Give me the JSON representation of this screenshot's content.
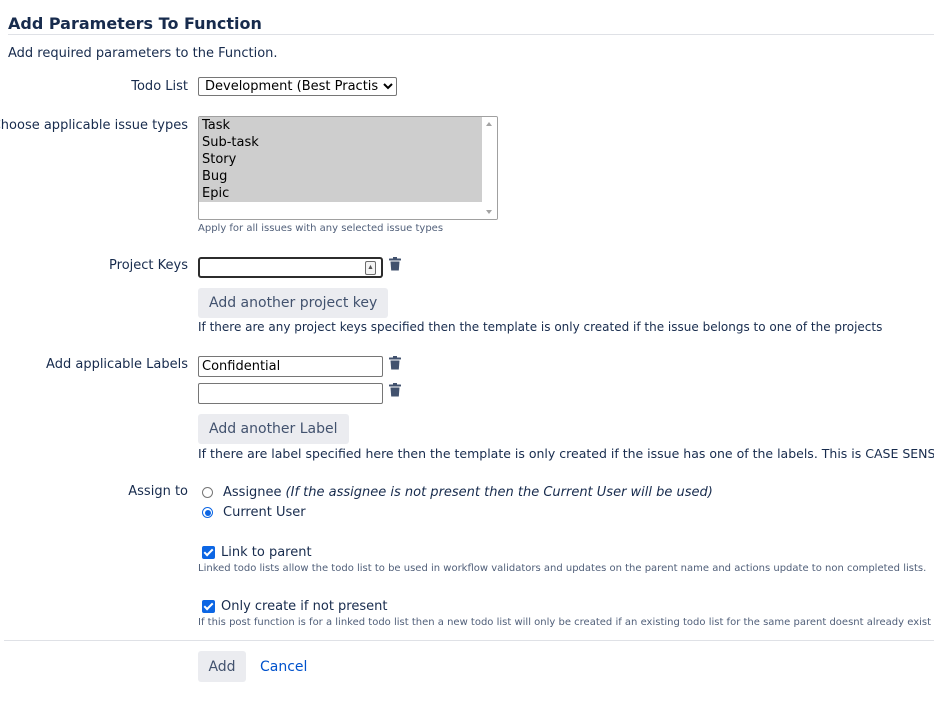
{
  "dialog": {
    "title": "Add Parameters To Function",
    "description": "Add required parameters to the Function."
  },
  "todo_list": {
    "label": "Todo List",
    "selected": "Development (Best Practises)"
  },
  "issue_types": {
    "label": "Choose applicable issue types",
    "options": [
      "Task",
      "Sub-task",
      "Story",
      "Bug",
      "Epic"
    ],
    "hint": "Apply for all issues with any selected issue types"
  },
  "project_keys": {
    "label": "Project Keys",
    "value": "",
    "add_label": "Add another project key",
    "hint": "If there are any project keys specified then the template is only created if the issue belongs to one of the projects"
  },
  "labels": {
    "label": "Add applicable Labels",
    "values": [
      "Confidential",
      ""
    ],
    "add_label": "Add another Label",
    "hint": "If there are label specified here then the template is only created if the issue has one of the labels. This is CASE SENSITIVE."
  },
  "assign": {
    "label": "Assign to",
    "assignee": "Assignee",
    "assignee_note": "(If the assignee is not present then the Current User will be used)",
    "current_user": "Current User",
    "selected": "Current User"
  },
  "link_parent": {
    "label": "Link to parent",
    "checked": true,
    "hint": "Linked todo lists allow the todo list to be used in workflow validators and updates on the parent name and actions update to non completed lists."
  },
  "only_create": {
    "label": "Only create if not present",
    "checked": true,
    "hint": "If this post function is for a linked todo list then a new todo list will only be created if an existing todo list for the same parent doesnt already exist"
  },
  "footer": {
    "add": "Add",
    "cancel": "Cancel"
  },
  "colors": {
    "link": "#0052cc",
    "accent": "#0c66e4",
    "button_bg": "#ebecf0",
    "selected_option_bg": "#cecece"
  }
}
